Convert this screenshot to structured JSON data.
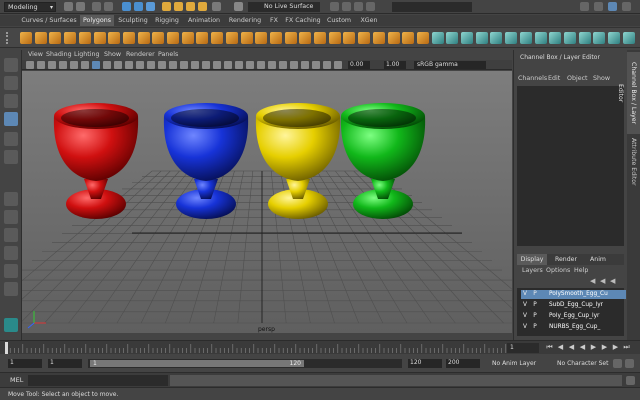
{
  "status_line": {
    "workspace_menu": "Modeling",
    "live_surface": "No Live Surface"
  },
  "shelf_tabs": [
    "Curves / Surfaces",
    "Polygons",
    "Sculpting",
    "Rigging",
    "Animation",
    "Rendering",
    "FX",
    "FX Caching",
    "Custom",
    "XGen"
  ],
  "active_shelf_tab": "Polygons",
  "viewport": {
    "menus": [
      "View",
      "Shading",
      "Lighting",
      "Show",
      "Renderer",
      "Panels"
    ],
    "exposure": "0.00",
    "gamma": "1.00",
    "color_space": "sRGB gamma",
    "camera_label": "persp",
    "egg_cup_colors": [
      "#d01010",
      "#1733d8",
      "#e6cf00",
      "#11b81a"
    ]
  },
  "channel_box": {
    "title": "Channel Box / Layer Editor",
    "menus": [
      "Channels",
      "Edit",
      "Object",
      "Show"
    ]
  },
  "layer_editor": {
    "tabs": [
      "Display",
      "Render",
      "Anim"
    ],
    "active_tab": "Display",
    "menus": [
      "Layers",
      "Options",
      "Help"
    ],
    "layers": [
      {
        "v": "V",
        "p": "P",
        "name": "PolySmooth_Egg_Cu",
        "selected": true
      },
      {
        "v": "V",
        "p": "P",
        "name": "SubD_Egg_Cup_lyr",
        "selected": false
      },
      {
        "v": "V",
        "p": "P",
        "name": "Poly_Egg_Cup_lyr",
        "selected": false
      },
      {
        "v": "V",
        "p": "P",
        "name": "NURBS_Egg_Cup_",
        "selected": false
      }
    ]
  },
  "side_tabs": [
    "Channel Box / Layer Editor",
    "Attribute Editor"
  ],
  "timeline": {
    "current_frame": "1"
  },
  "range": {
    "start": "1",
    "inner_start": "1",
    "slider_start": "1",
    "slider_end": "120",
    "inner_end": "120",
    "end": "200",
    "anim_layer": "No Anim Layer",
    "character_set": "No Character Set"
  },
  "mel": {
    "label": "MEL"
  },
  "help_line": "Move Tool: Select an object to move."
}
